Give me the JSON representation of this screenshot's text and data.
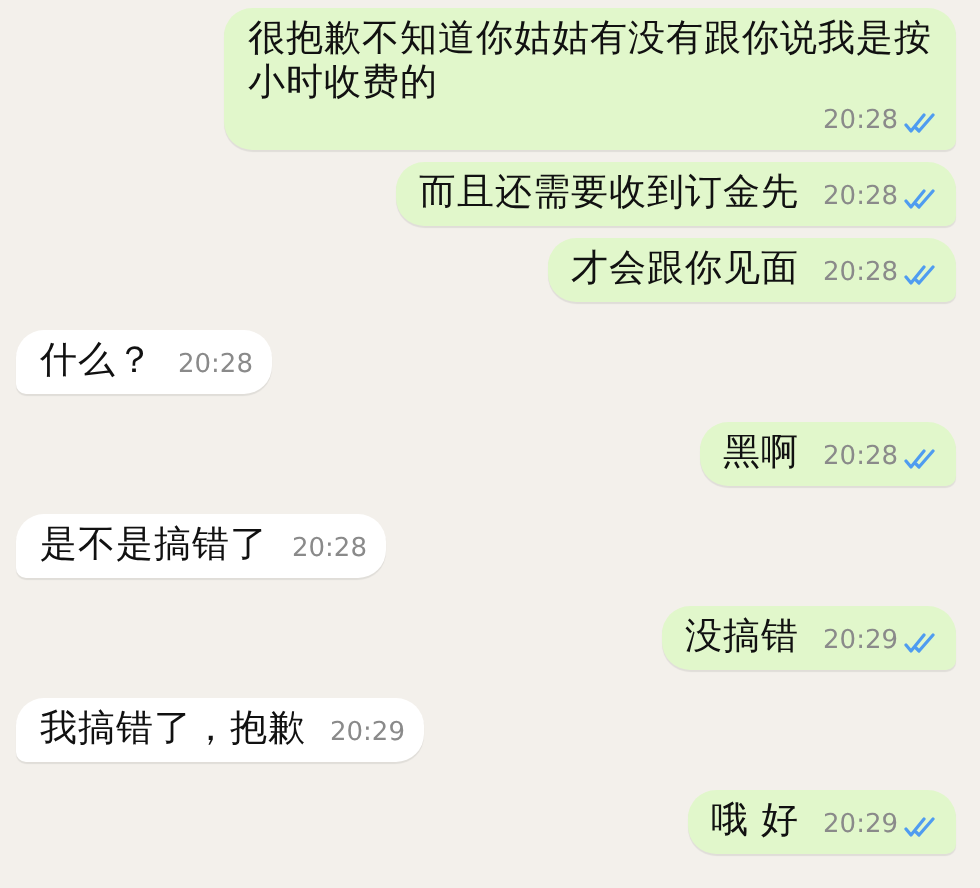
{
  "messages": [
    {
      "outgoing": true,
      "text": "很抱歉不知道你姑姑有没有跟你说我是按小时收费的",
      "time": "20:28",
      "read": true
    },
    {
      "outgoing": true,
      "text": "而且还需要收到订金先",
      "time": "20:28",
      "read": true
    },
    {
      "outgoing": true,
      "text": "才会跟你见面",
      "time": "20:28",
      "read": true
    },
    {
      "outgoing": false,
      "text": "什么？",
      "time": "20:28"
    },
    {
      "outgoing": true,
      "text": "黑啊",
      "time": "20:28",
      "read": true
    },
    {
      "outgoing": false,
      "text": "是不是搞错了",
      "time": "20:28"
    },
    {
      "outgoing": true,
      "text": "没搞错",
      "time": "20:29",
      "read": true
    },
    {
      "outgoing": false,
      "text": "我搞错了，抱歉",
      "time": "20:29"
    },
    {
      "outgoing": true,
      "text": "哦 好",
      "time": "20:29",
      "read": true
    }
  ]
}
